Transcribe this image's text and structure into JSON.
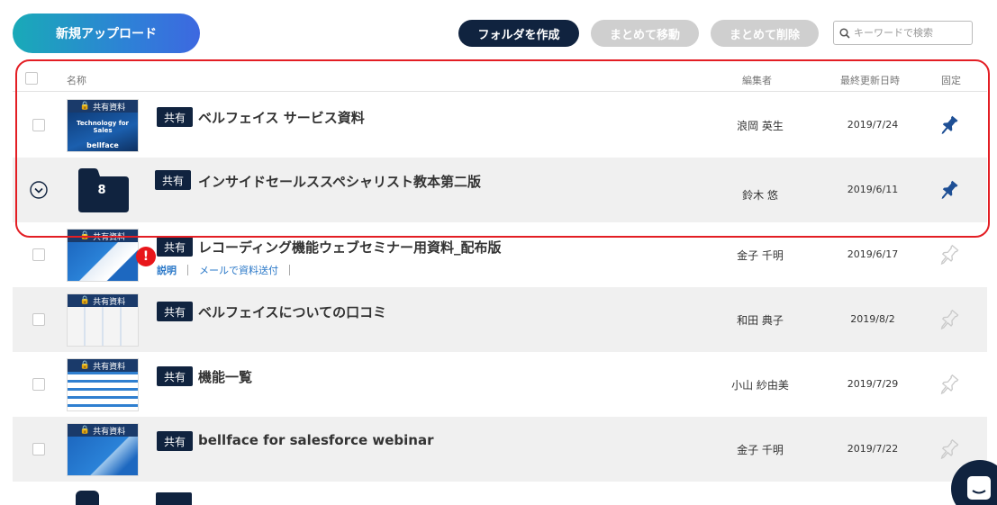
{
  "toolbar": {
    "upload_label": "新規アップロード",
    "create_folder_label": "フォルダを作成",
    "bulk_move_label": "まとめて移動",
    "bulk_delete_label": "まとめて削除",
    "search_placeholder": "キーワードで検索"
  },
  "table": {
    "headers": {
      "name": "名称",
      "editor": "編集者",
      "updated": "最終更新日時",
      "pinned": "固定"
    },
    "rows": [
      {
        "type": "file",
        "badge": "共有",
        "title": "ベルフェイス サービス資料",
        "editor": "浪岡 英生",
        "date": "2019/7/24",
        "pinned": true,
        "thumb_label": "共有資料",
        "thumb_text": "Technology for Sales",
        "thumb_logo": "bellface"
      },
      {
        "type": "folder",
        "badge": "共有",
        "title": "インサイドセールススペシャリスト教本第二版",
        "editor": "鈴木 悠",
        "date": "2019/6/11",
        "pinned": true,
        "folder_count": "8"
      },
      {
        "type": "file",
        "badge": "共有",
        "title": "レコーディング機能ウェブセミナー用資料_配布版",
        "editor": "金子 千明",
        "date": "2019/6/17",
        "pinned": false,
        "thumb_label": "共有資料",
        "alert": "!",
        "links": [
          "説明",
          "メールで資料送付"
        ]
      },
      {
        "type": "file",
        "badge": "共有",
        "title": "ベルフェイスについての口コミ",
        "editor": "和田 典子",
        "date": "2019/8/2",
        "pinned": false,
        "thumb_label": "共有資料"
      },
      {
        "type": "file",
        "badge": "共有",
        "title": "機能一覧",
        "editor": "小山 紗由美",
        "date": "2019/7/29",
        "pinned": false,
        "thumb_label": "共有資料"
      },
      {
        "type": "file",
        "badge": "共有",
        "title": "bellface for salesforce webinar",
        "editor": "金子 千明",
        "date": "2019/7/22",
        "pinned": false,
        "thumb_label": "共有資料"
      }
    ]
  },
  "colors": {
    "navy": "#10233f",
    "highlight_border": "#e31e24",
    "pin_active": "#1e4f95",
    "pin_inactive": "#c9c9c9",
    "link": "#2a78c8",
    "alert": "#e8161b"
  },
  "icons": [
    "search-icon",
    "lock-icon",
    "pin-icon",
    "chevron-down-icon",
    "folder-icon",
    "chat-icon"
  ]
}
